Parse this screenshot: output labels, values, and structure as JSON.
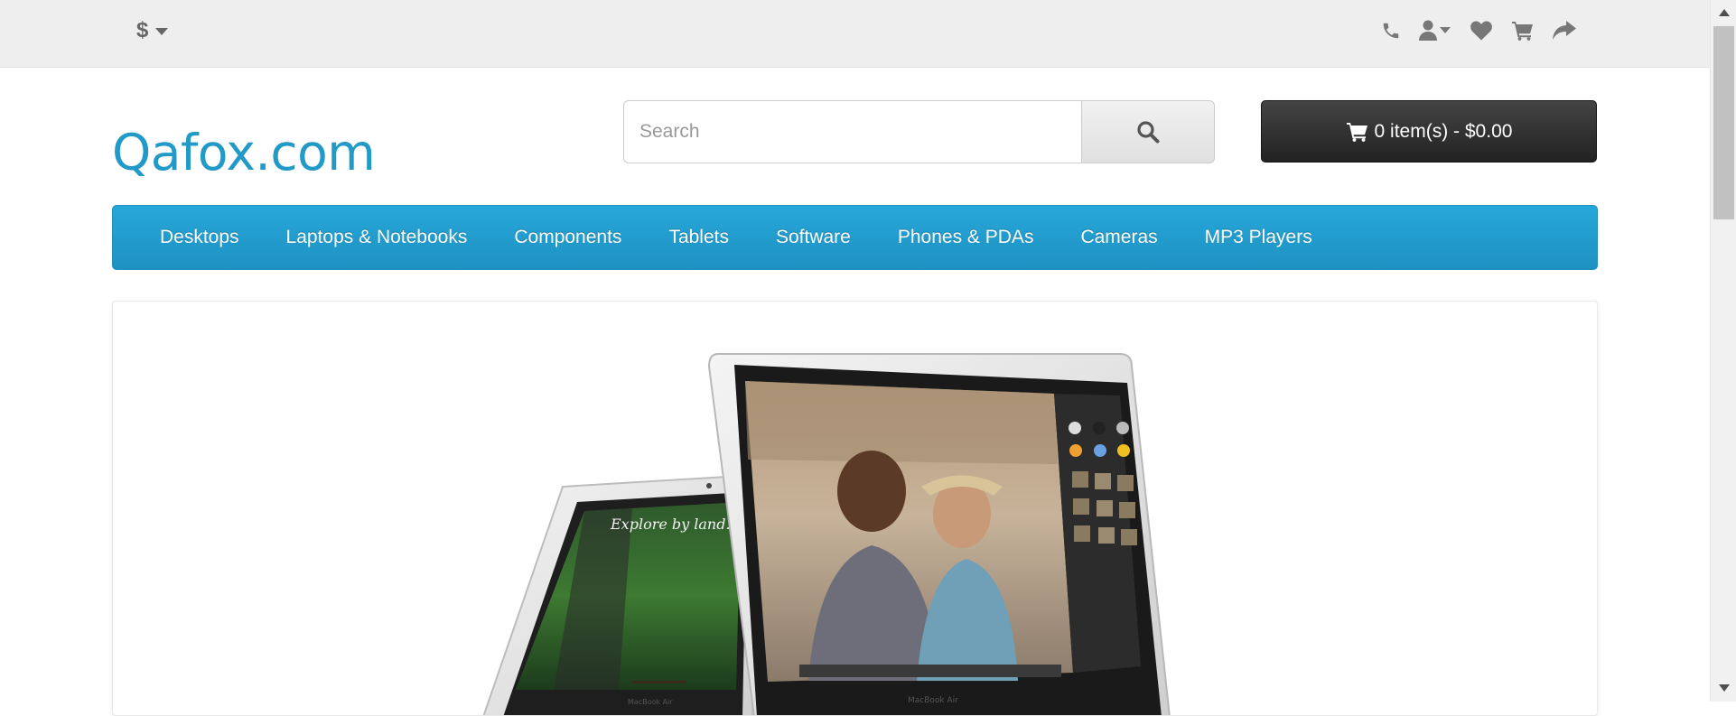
{
  "top_bar": {
    "currency": {
      "symbol": "$",
      "icon": "caret-down-icon"
    },
    "links": [
      {
        "name": "phone",
        "icon": "phone-icon"
      },
      {
        "name": "my-account",
        "icon": "user-icon"
      },
      {
        "name": "wishlist",
        "icon": "heart-icon"
      },
      {
        "name": "shopping-cart",
        "icon": "cart-icon"
      },
      {
        "name": "checkout",
        "icon": "share-icon"
      }
    ],
    "icon_color": "#777777"
  },
  "header": {
    "logo_text": "Qafox.com",
    "logo_color": "#229ac8",
    "search": {
      "placeholder": "Search",
      "value": "",
      "button_icon": "search-icon"
    },
    "cart": {
      "icon": "cart-icon",
      "label": "0 item(s) - $0.00"
    }
  },
  "menu": {
    "background": "#229ac8",
    "items": [
      {
        "label": "Desktops"
      },
      {
        "label": "Laptops & Notebooks"
      },
      {
        "label": "Components"
      },
      {
        "label": "Tablets"
      },
      {
        "label": "Software"
      },
      {
        "label": "Phones & PDAs"
      },
      {
        "label": "Cameras"
      },
      {
        "label": "MP3 Players"
      }
    ]
  },
  "slideshow": {
    "image_subject": "macbook-air-laptops",
    "screen_text": "Explore by land.",
    "laptop_brand_label": "MacBook Air"
  }
}
